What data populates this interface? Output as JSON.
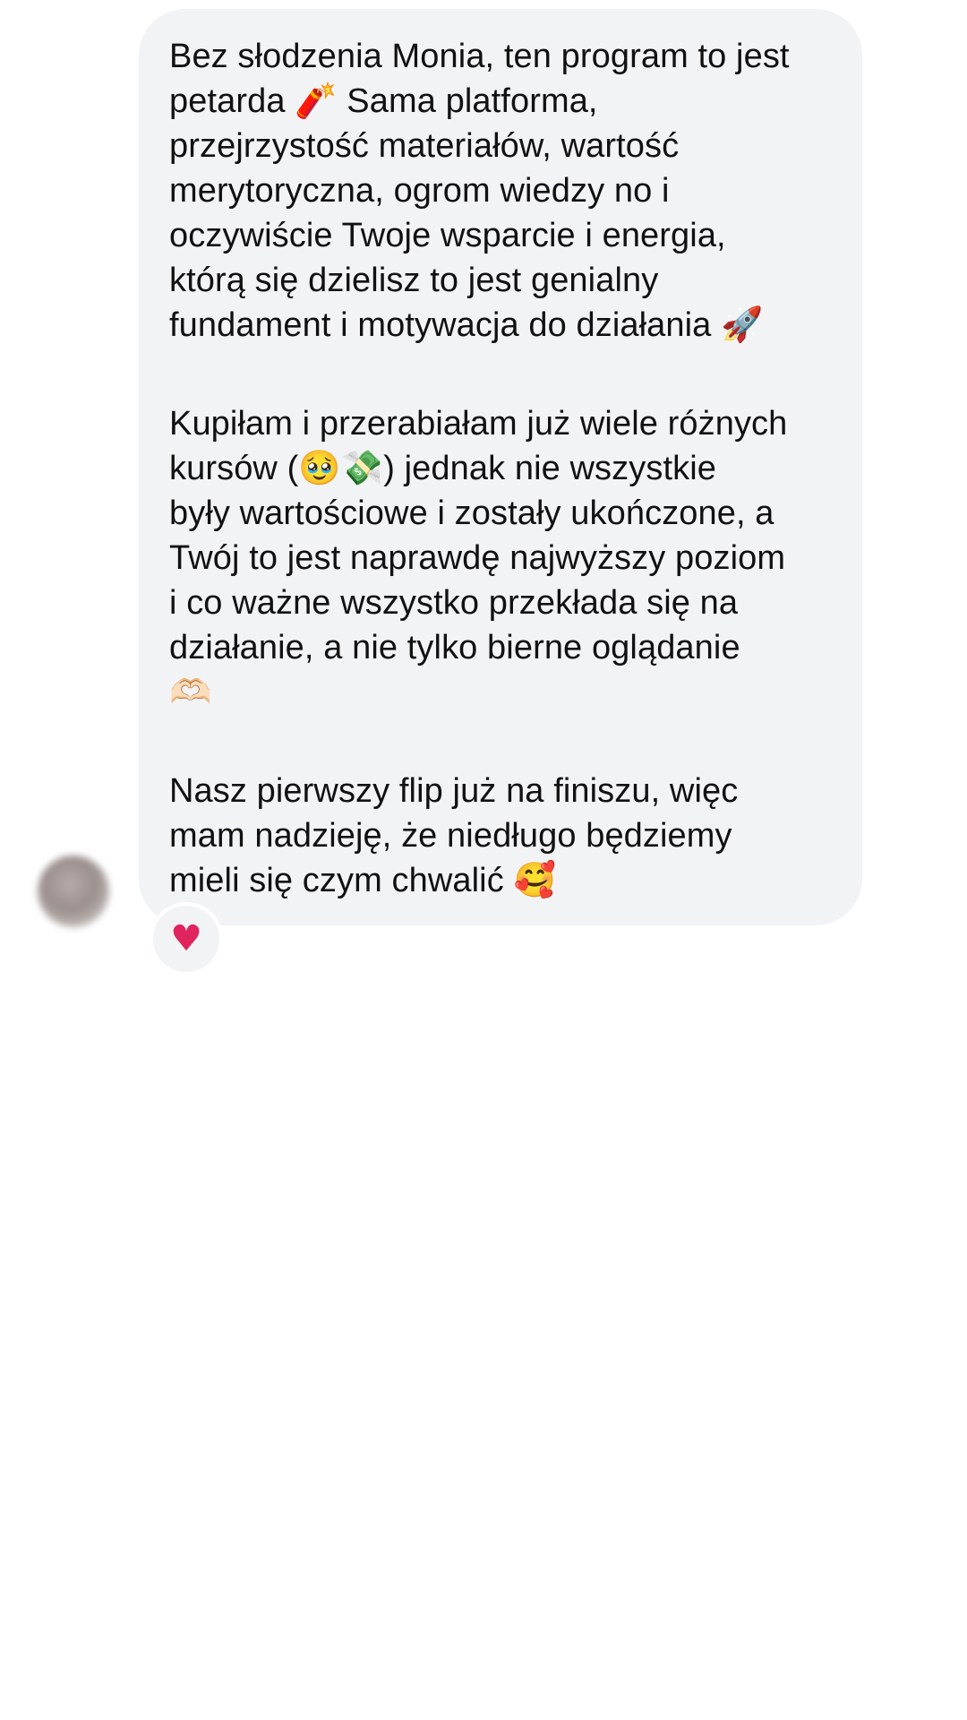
{
  "message": {
    "paragraphs": [
      "Bez słodzenia Monia, ten program to jest\npetarda 🧨 Sama platforma,\nprzejrzystość materiałów, wartość\nmerytoryczna, ogrom wiedzy no i\noczywiście Twoje wsparcie i energia,\nktórą się dzielisz to jest genialny\nfundament i motywacja do działania 🚀",
      "Kupiłam i przerabiałam już wiele różnych\nkursów (🥹💸) jednak nie wszystkie\nbyły wartościowe i zostały ukończone, a\nTwój to jest naprawdę najwyższy poziom\ni co ważne wszystko przekłada się na\ndziałanie, a nie tylko bierne oglądanie\n🫶🏻",
      "Nasz pierwszy flip już na finiszu, więc\nmam nadzieję, że niedługo będziemy\nmieli się czym chwalić 🥰"
    ],
    "reaction": "♥",
    "bubble_color": "#f2f3f5",
    "text_color": "#111111",
    "reaction_color": "#e0245e"
  }
}
